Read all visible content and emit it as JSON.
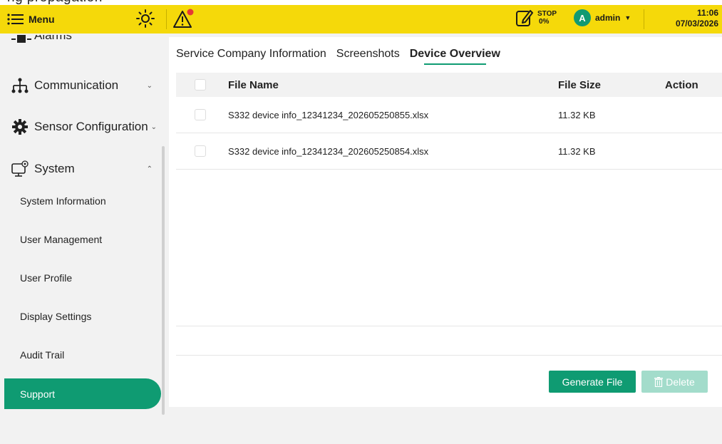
{
  "topbar": {
    "menu_label": "Menu",
    "stop_label": "STOP",
    "stop_percent": "0%",
    "avatar_letter": "A",
    "user_name": "admin",
    "time": "11:06",
    "date": "07/03/2026",
    "colors": {
      "bar": "#f5d90a",
      "alert_dot": "#e53935"
    }
  },
  "sidebar": {
    "top_cropped_label": "Alarms",
    "groups": [
      {
        "label": "Communication",
        "icon": "network-icon"
      },
      {
        "label": "Sensor Configuration",
        "icon": "gear-icon"
      },
      {
        "label": "System",
        "icon": "monitor-gear-icon"
      }
    ],
    "system_items": [
      "System Information",
      "User Management",
      "User Profile",
      "Display Settings",
      "Audit Trail"
    ],
    "active_item": "Support",
    "accent": "#0f9b72"
  },
  "tabs": [
    "Service Company Information",
    "Screenshots",
    "Device Overview"
  ],
  "active_tab": "Device Overview",
  "table": {
    "columns": [
      "File Name",
      "File Size",
      "Action"
    ],
    "rows": [
      {
        "name": "S332 device info_12341234_202605250855.xlsx",
        "size": "11.32 KB"
      },
      {
        "name": "S332 device info_12341234_202605250854.xlsx",
        "size": "11.32 KB"
      }
    ]
  },
  "buttons": {
    "generate": "Generate File",
    "delete": "Delete"
  }
}
